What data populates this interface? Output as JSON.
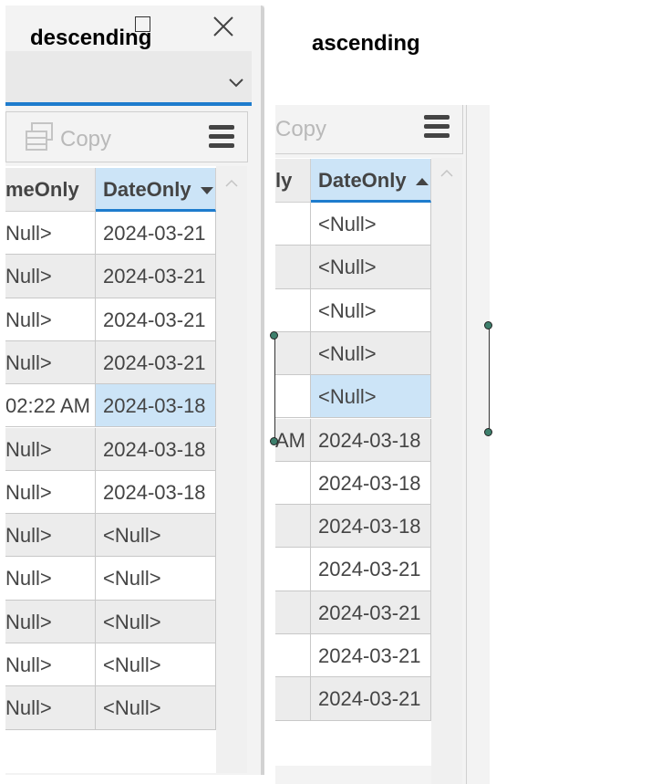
{
  "left_panel": {
    "title": "descending",
    "toolbar": {
      "copy_label": "Copy"
    },
    "grid": {
      "columns": [
        {
          "label": "meOnly",
          "sorted": false
        },
        {
          "label": "DateOnly",
          "sorted": true,
          "direction": "descending"
        }
      ],
      "rows": [
        [
          "Null>",
          "2024-03-21"
        ],
        [
          "Null>",
          "2024-03-21"
        ],
        [
          "Null>",
          "2024-03-21"
        ],
        [
          "Null>",
          "2024-03-21"
        ],
        [
          "02:22 AM",
          "2024-03-18"
        ],
        [
          "Null>",
          "2024-03-18"
        ],
        [
          "Null>",
          "2024-03-18"
        ],
        [
          "Null>",
          "<Null>"
        ],
        [
          "Null>",
          "<Null>"
        ],
        [
          "Null>",
          "<Null>"
        ],
        [
          "Null>",
          "<Null>"
        ],
        [
          "Null>",
          "<Null>"
        ]
      ],
      "selected_row": 4
    }
  },
  "right_panel": {
    "title": "ascending",
    "toolbar": {
      "copy_label": "Copy"
    },
    "grid": {
      "columns": [
        {
          "label": "ly",
          "sorted": false
        },
        {
          "label": "DateOnly",
          "sorted": true,
          "direction": "ascending"
        }
      ],
      "rows": [
        [
          "",
          "<Null>"
        ],
        [
          "",
          "<Null>"
        ],
        [
          "",
          "<Null>"
        ],
        [
          "",
          "<Null>"
        ],
        [
          "",
          "<Null>"
        ],
        [
          "AM",
          "2024-03-18"
        ],
        [
          "",
          "2024-03-18"
        ],
        [
          "",
          "2024-03-18"
        ],
        [
          "",
          "2024-03-21"
        ],
        [
          "",
          "2024-03-21"
        ],
        [
          "",
          "2024-03-21"
        ],
        [
          "",
          "2024-03-21"
        ]
      ],
      "selected_row": 4
    }
  },
  "colors": {
    "accent": "#1e7ccd",
    "selected_cell": "#cce4f7",
    "zebra": "#ececec",
    "handle": "#3d7f6c"
  },
  "icons": [
    "maximize-icon",
    "close-icon",
    "chevron-down-icon",
    "copy-icon",
    "hamburger-menu-icon",
    "scroll-up-icon"
  ]
}
